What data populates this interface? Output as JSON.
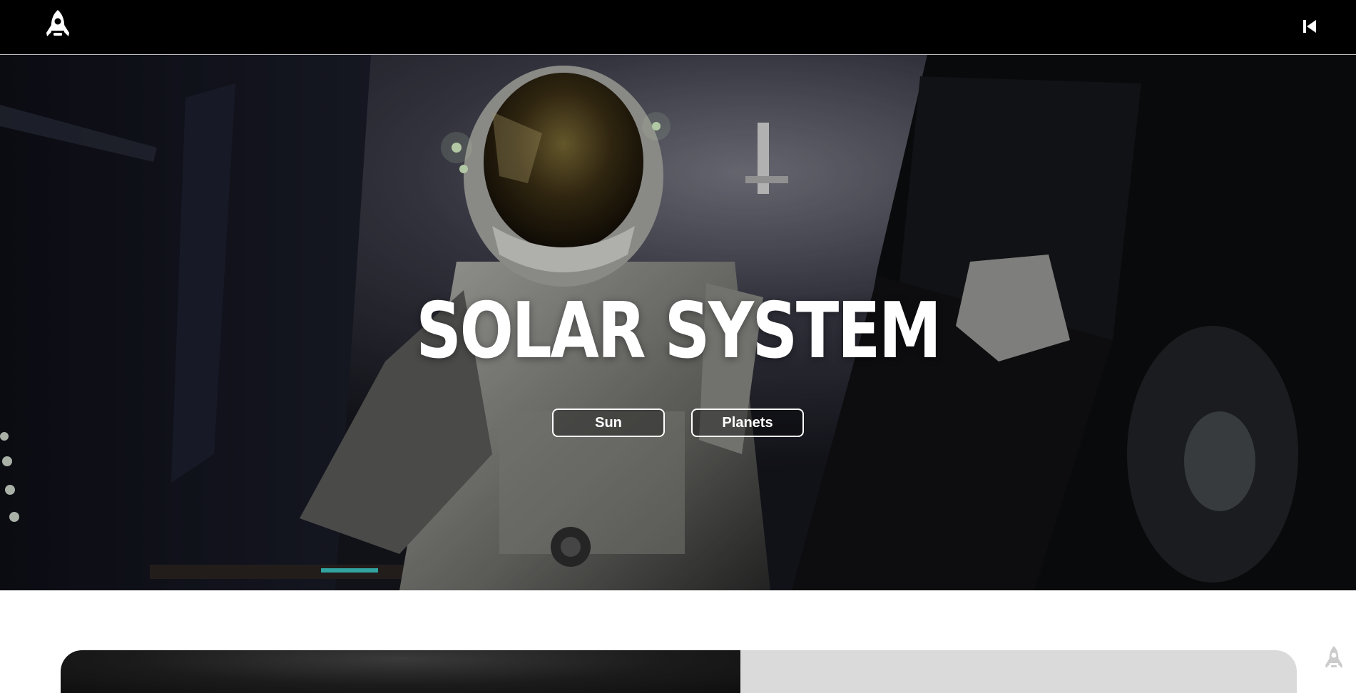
{
  "header": {
    "logo_icon": "rocket-icon",
    "skip_icon": "skip-back-icon"
  },
  "hero": {
    "title": "SOLAR SYSTEM",
    "buttons": {
      "sun": "Sun",
      "planets": "Planets"
    },
    "background": "astronaut-in-spaceship-image"
  },
  "floating": {
    "corner_icon": "rocket-icon"
  },
  "colors": {
    "header_bg": "#000000",
    "hero_text": "#ffffff",
    "card_light": "#dadada",
    "card_dark": "#1b1b1b"
  }
}
